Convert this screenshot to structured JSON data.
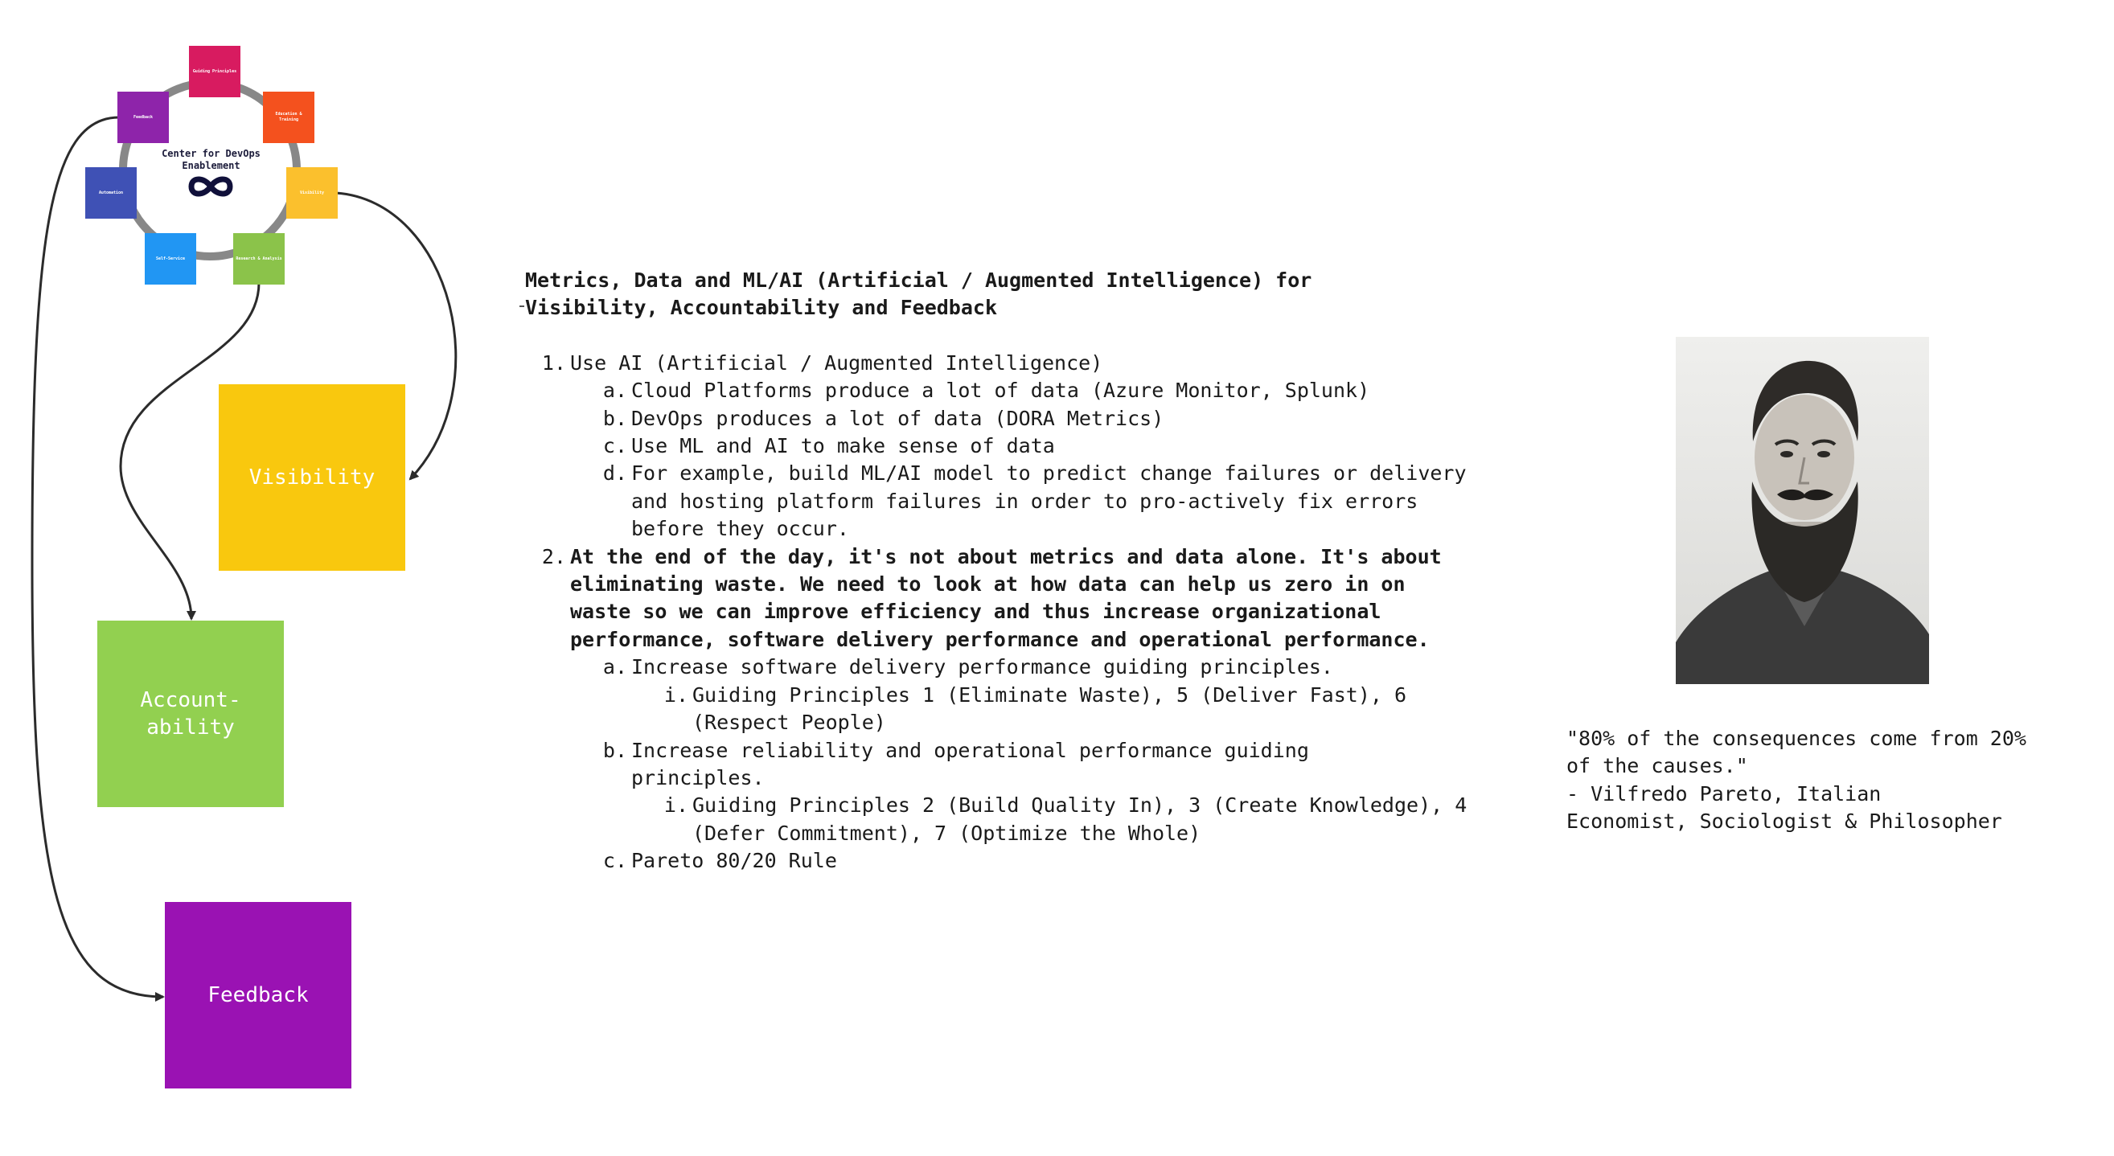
{
  "ring": {
    "center_title": "Center for DevOps Enablement",
    "tiles": [
      {
        "label": "Guiding Principles",
        "color": "#d81b60"
      },
      {
        "label": "Education & Training",
        "color": "#f4511e"
      },
      {
        "label": "Visibility",
        "color": "#fbc02d"
      },
      {
        "label": "Research & Analysis",
        "color": "#8bc34a"
      },
      {
        "label": "Self-Service",
        "color": "#2196f3"
      },
      {
        "label": "Automation",
        "color": "#3f51b5"
      },
      {
        "label": "Feedback",
        "color": "#8e24aa"
      }
    ]
  },
  "boxes": {
    "visibility": {
      "label": "Visibility",
      "color": "#f9c80e"
    },
    "accountability": {
      "label": "Account-\nability",
      "color": "#92d050"
    },
    "feedback": {
      "label": "Feedback",
      "color": "#9a12b3"
    }
  },
  "main": {
    "title": "Metrics, Data and ML/AI (Artificial / Augmented Intelligence) for\nVisibility, Accountability and Feedback",
    "items": [
      {
        "marker": "1.",
        "text": "Use AI (Artificial / Augmented Intelligence)",
        "sub": [
          {
            "marker": "a.",
            "text": "Cloud Platforms produce a lot of data (Azure Monitor, Splunk)"
          },
          {
            "marker": "b.",
            "text": "DevOps produces a lot of data (DORA Metrics)"
          },
          {
            "marker": "c.",
            "text": "Use ML and AI to make sense of data"
          },
          {
            "marker": "d.",
            "text": "For example, build ML/AI model to predict change failures or delivery and hosting platform failures in order to pro-actively fix errors before they occur."
          }
        ]
      },
      {
        "marker": "2.",
        "text": "At the end of the day, it's not about metrics and data alone.  It's about eliminating waste.  We need to look at how data can help us zero in on waste so we can improve efficiency and thus increase organizational performance, software delivery performance and operational performance.",
        "sub": [
          {
            "marker": "a.",
            "text": "Increase software delivery performance guiding principles.",
            "sub": [
              {
                "marker": "i.",
                "text": "Guiding Principles 1 (Eliminate Waste), 5 (Deliver Fast), 6 (Respect People)"
              }
            ]
          },
          {
            "marker": "b.",
            "text": "Increase reliability and operational performance guiding principles.",
            "sub": [
              {
                "marker": "i.",
                "text": "Guiding Principles 2 (Build Quality In), 3 (Create Knowledge), 4 (Defer Commitment), 7 (Optimize the Whole)"
              }
            ]
          },
          {
            "marker": "c.",
            "text": "Pareto 80/20 Rule"
          }
        ]
      }
    ]
  },
  "quote": {
    "text": "\"80% of the consequences come from 20%\nof the causes.\"\n      - Vilfredo Pareto, Italian\nEconomist, Sociologist & Philosopher"
  }
}
